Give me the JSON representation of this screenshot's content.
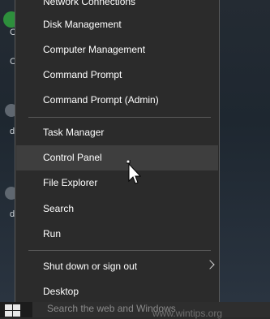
{
  "menu": {
    "items": [
      {
        "label": "Network Connections",
        "hovered": false
      },
      {
        "label": "Disk Management",
        "hovered": false
      },
      {
        "label": "Computer Management",
        "hovered": false
      },
      {
        "label": "Command Prompt",
        "hovered": false
      },
      {
        "label": "Command Prompt (Admin)",
        "hovered": false
      },
      {
        "label": "Task Manager",
        "hovered": false
      },
      {
        "label": "Control Panel",
        "hovered": true
      },
      {
        "label": "File Explorer",
        "hovered": false
      },
      {
        "label": "Search",
        "hovered": false
      },
      {
        "label": "Run",
        "hovered": false
      },
      {
        "label": "Shut down or sign out",
        "hovered": false,
        "submenu": true
      },
      {
        "label": "Desktop",
        "hovered": false
      }
    ]
  },
  "desktop": {
    "icon_texts": [
      "C",
      "C",
      "d",
      "d"
    ]
  },
  "taskbar": {
    "search_placeholder": "Search the web and Windows"
  },
  "watermark": "www.wintips.org",
  "colors": {
    "menu_bg": "#2b2b2b",
    "menu_hover": "#3e3e3e",
    "menu_text": "#ffffff",
    "taskbar_bg": "#1c1c1c"
  }
}
